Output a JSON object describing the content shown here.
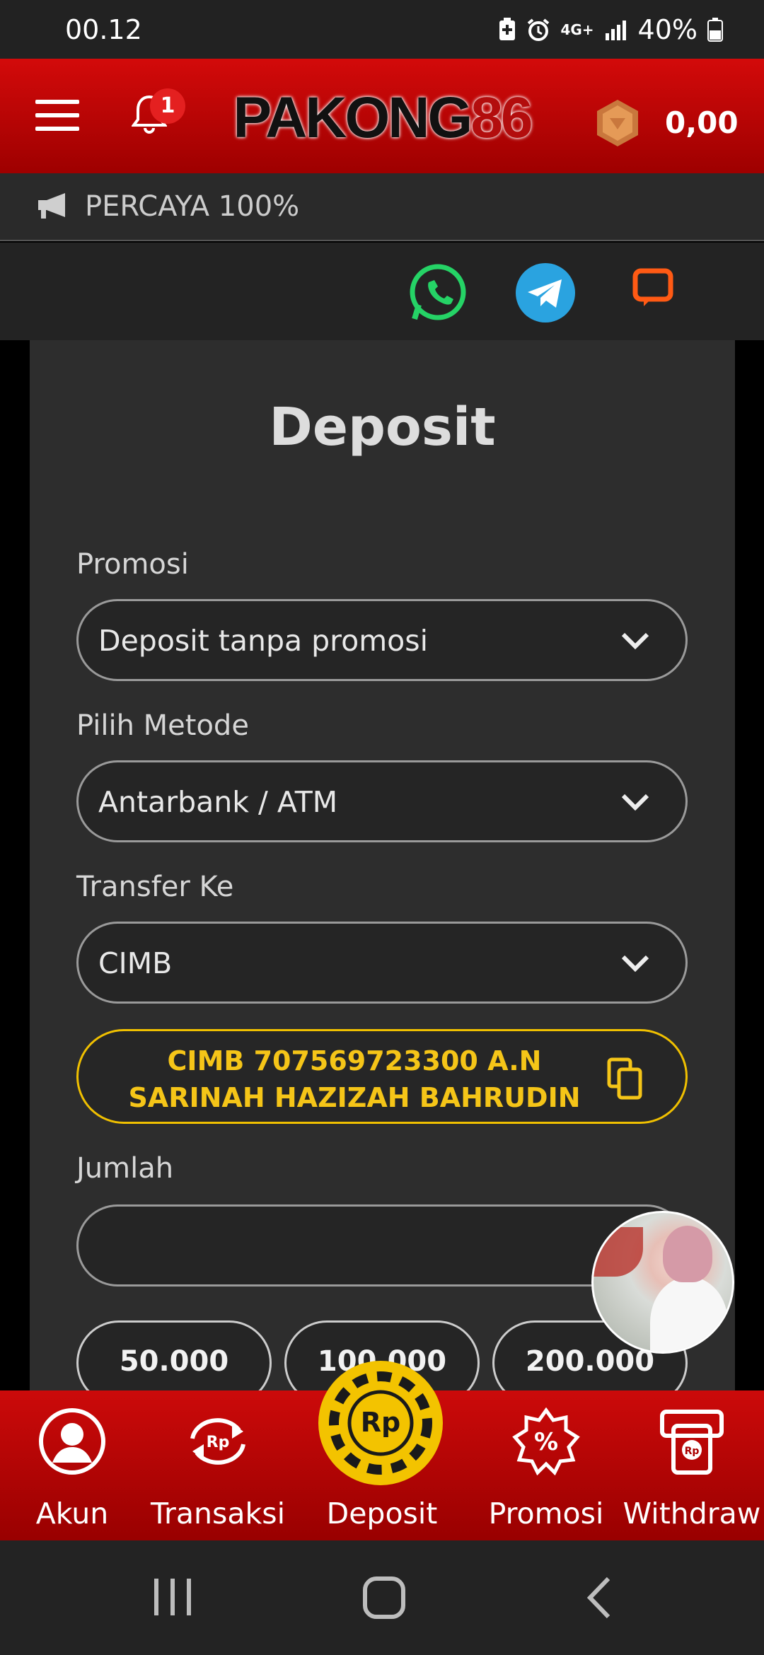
{
  "status_bar": {
    "time": "00.12",
    "network": "4G+",
    "battery": "40%"
  },
  "header": {
    "logo_text": "PAKONG",
    "logo_num": "86",
    "notification_count": "1",
    "balance": "0,00"
  },
  "marquee": {
    "text": "PERCAYA 100%"
  },
  "social": [
    "whatsapp-icon",
    "telegram-icon",
    "livechat-icon"
  ],
  "form": {
    "title": "Deposit",
    "promo_label": "Promosi",
    "promo_value": "Deposit tanpa promosi",
    "method_label": "Pilih Metode",
    "method_value": "Antarbank / ATM",
    "transfer_label": "Transfer Ke",
    "transfer_value": "CIMB",
    "bank_line1": "CIMB 707569723300 A.N",
    "bank_line2": "SARINAH HAZIZAH BAHRUDIN",
    "amount_label": "Jumlah",
    "amount_value": "",
    "quick_amounts": [
      "50.000",
      "100.000",
      "200.000"
    ]
  },
  "bottom_nav": {
    "items": [
      {
        "label": "Akun",
        "icon": "user-icon"
      },
      {
        "label": "Transaksi",
        "icon": "transaction-icon"
      },
      {
        "label": "Deposit",
        "icon": "rp-chip-icon"
      },
      {
        "label": "Promosi",
        "icon": "percent-badge-icon"
      },
      {
        "label": "Withdraw",
        "icon": "atm-icon"
      }
    ]
  },
  "colors": {
    "brand_red": "#cc0a0a",
    "accent_gold": "#f3c300",
    "panel": "#2d2d2d"
  }
}
